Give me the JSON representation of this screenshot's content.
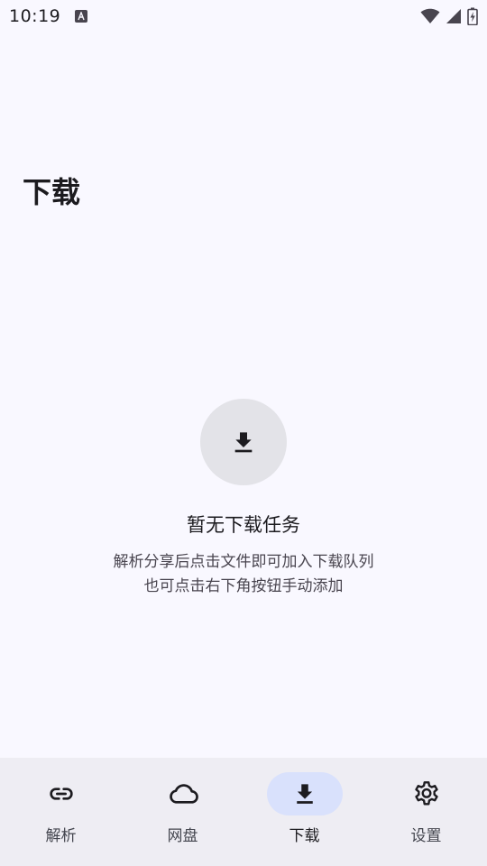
{
  "status_bar": {
    "time": "10:19",
    "icons": [
      "notification-a-icon",
      "wifi-icon",
      "signal-icon",
      "battery-charging-icon"
    ]
  },
  "page": {
    "title": "下载"
  },
  "empty_state": {
    "icon": "download-icon",
    "title": "暂无下载任务",
    "desc_line1": "解析分享后点击文件即可加入下载队列",
    "desc_line2": "也可点击右下角按钮手动添加"
  },
  "bottom_nav": {
    "items": [
      {
        "label": "解析",
        "icon": "link-icon",
        "active": false
      },
      {
        "label": "网盘",
        "icon": "cloud-icon",
        "active": false
      },
      {
        "label": "下载",
        "icon": "download-icon",
        "active": true
      },
      {
        "label": "设置",
        "icon": "gear-icon",
        "active": false
      }
    ]
  },
  "colors": {
    "background": "#f9f8ff",
    "nav_background": "#eeedf3",
    "active_pill": "#d9e1fc",
    "empty_circle": "#e3e3e8",
    "text_primary": "#1c1b1f",
    "text_secondary": "#49454f"
  }
}
